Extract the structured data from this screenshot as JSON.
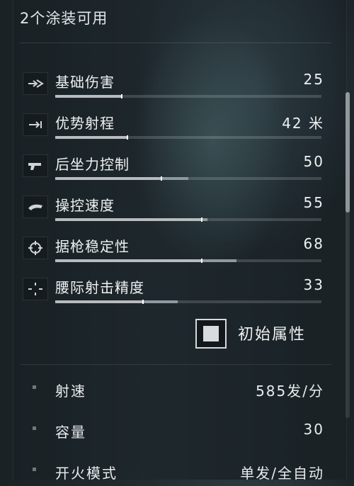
{
  "header": {
    "title": "2个涂装可用"
  },
  "stats": [
    {
      "label": "基础伤害",
      "value": "25",
      "icon": "bullet-impact-icon",
      "level": 0.25,
      "extra": 0.0
    },
    {
      "label": "优势射程",
      "value": "42 米",
      "icon": "range-arrow-icon",
      "level": 0.27,
      "extra": 0.0
    },
    {
      "label": "后坐力控制",
      "value": "50",
      "icon": "pistol-recoil-icon",
      "level": 0.4,
      "extra": 0.1
    },
    {
      "label": "操控速度",
      "value": "55",
      "icon": "handling-speed-icon",
      "level": 0.55,
      "extra": 0.02
    },
    {
      "label": "据枪稳定性",
      "value": "68",
      "icon": "crosshair-stability-icon",
      "level": 0.55,
      "extra": 0.13
    },
    {
      "label": "腰际射击精度",
      "value": "33",
      "icon": "hipfire-reticle-icon",
      "level": 0.33,
      "extra": 0.13
    }
  ],
  "base_attributes": {
    "label": "初始属性",
    "checked": true
  },
  "attributes": [
    {
      "label": "射速",
      "value": "585发/分"
    },
    {
      "label": "容量",
      "value": "30"
    },
    {
      "label": "开火模式",
      "value": "单发/全自动"
    }
  ],
  "colors": {
    "bar_fill": "#b8bcbf",
    "bar_ext": "#8f9aa0",
    "track": "#3a4246",
    "text": "#eef1f2"
  }
}
